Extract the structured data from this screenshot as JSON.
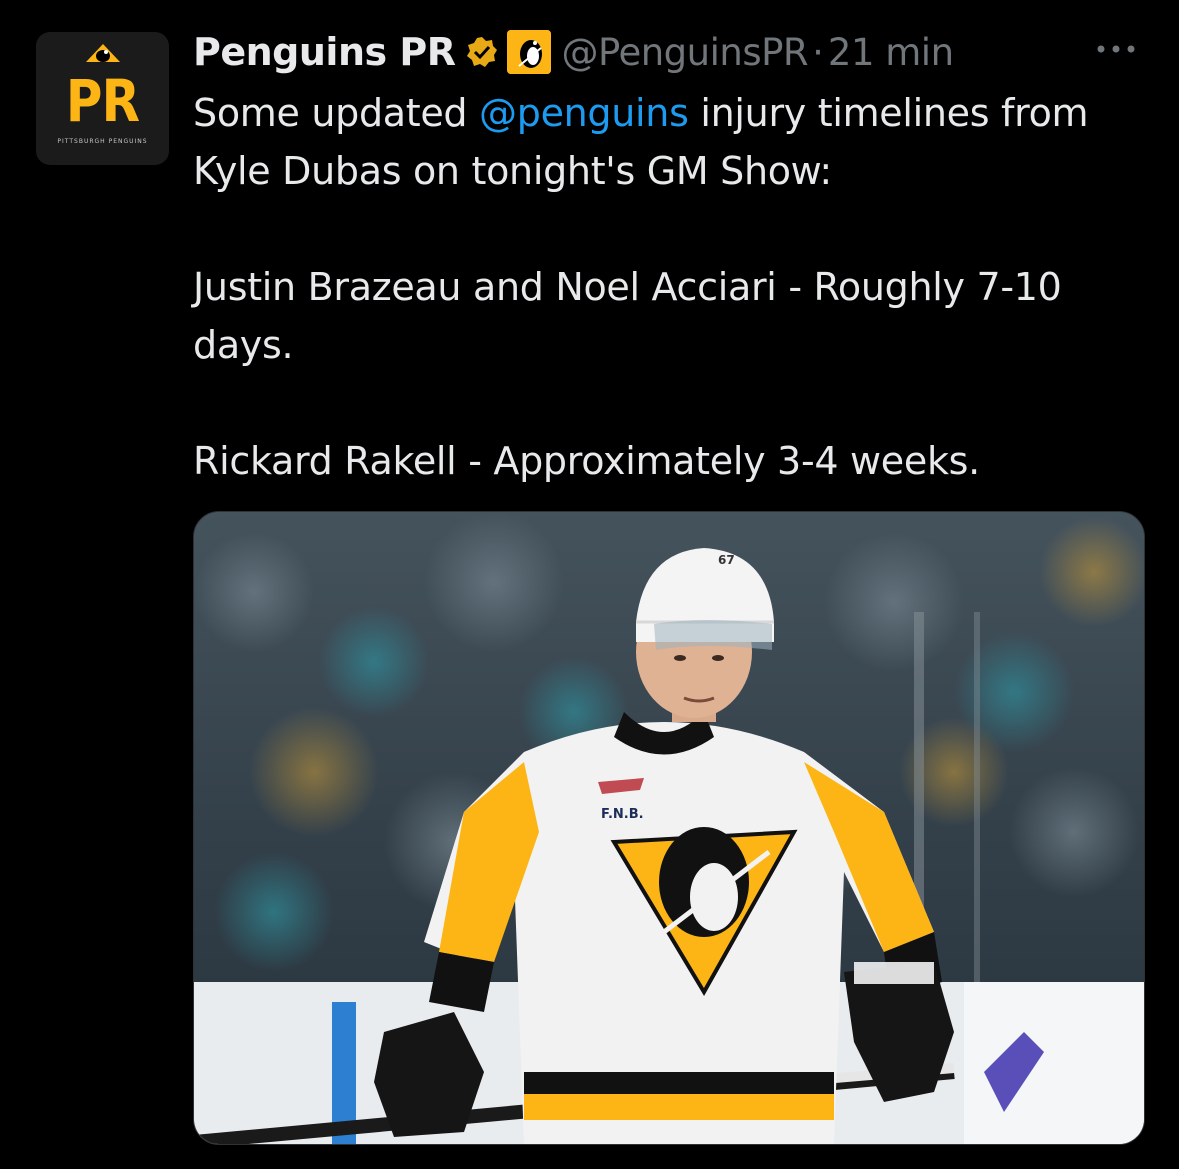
{
  "tweet": {
    "author_name": "Penguins PR",
    "handle": "@PenguinsPR",
    "separator": "·",
    "time": "21 min",
    "avatar": {
      "label": "PR",
      "sublabel": "PITTSBURGH PENGUINS"
    },
    "icons": {
      "verified": "verified-gold-badge-icon",
      "affiliate": "penguins-logo-icon",
      "more": "more-horizontal-icon"
    },
    "text_line1_prefix": "Some updated ",
    "mention": "@penguins",
    "text_line1_suffix": " injury timelines from Kyle Dubas on tonight's GM Show:",
    "paragraph2": "Justin Brazeau and Noel Acciari - Roughly 7-10 days.",
    "paragraph3": "Rickard Rakell - Approximately 3-4 weeks.",
    "image_text": {
      "sponsor": "F.N.B.",
      "number": "67"
    }
  },
  "colors": {
    "background": "#000000",
    "text": "#e7e9ea",
    "muted": "#71767b",
    "link": "#1d9bf0",
    "gold": "#fcb514"
  }
}
